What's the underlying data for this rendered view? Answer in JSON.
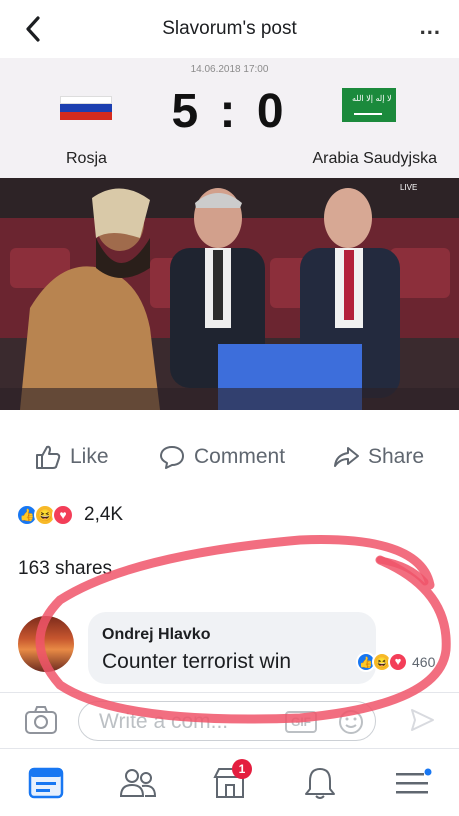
{
  "header": {
    "title": "Slavorum's post",
    "more_label": "..."
  },
  "scoreboard": {
    "date": "14.06.2018 17:00",
    "score": "5 : 0",
    "team_left": "Rosja",
    "team_right": "Arabia Saudyjska"
  },
  "actions": {
    "like": "Like",
    "comment": "Comment",
    "share": "Share"
  },
  "reactions": {
    "count": "2,4K"
  },
  "shares": {
    "text": "163 shares"
  },
  "comment": {
    "author": "Ondrej Hlavko",
    "text": "Counter terrorist win",
    "reaction_count": "460"
  },
  "composer": {
    "placeholder": "Write a com...",
    "gif_label": "GIF"
  },
  "bottom_nav": {
    "notification_badge": "1"
  },
  "colors": {
    "accent": "#1877f2",
    "circle": "#f0556a",
    "badge": "#e41e3f"
  }
}
